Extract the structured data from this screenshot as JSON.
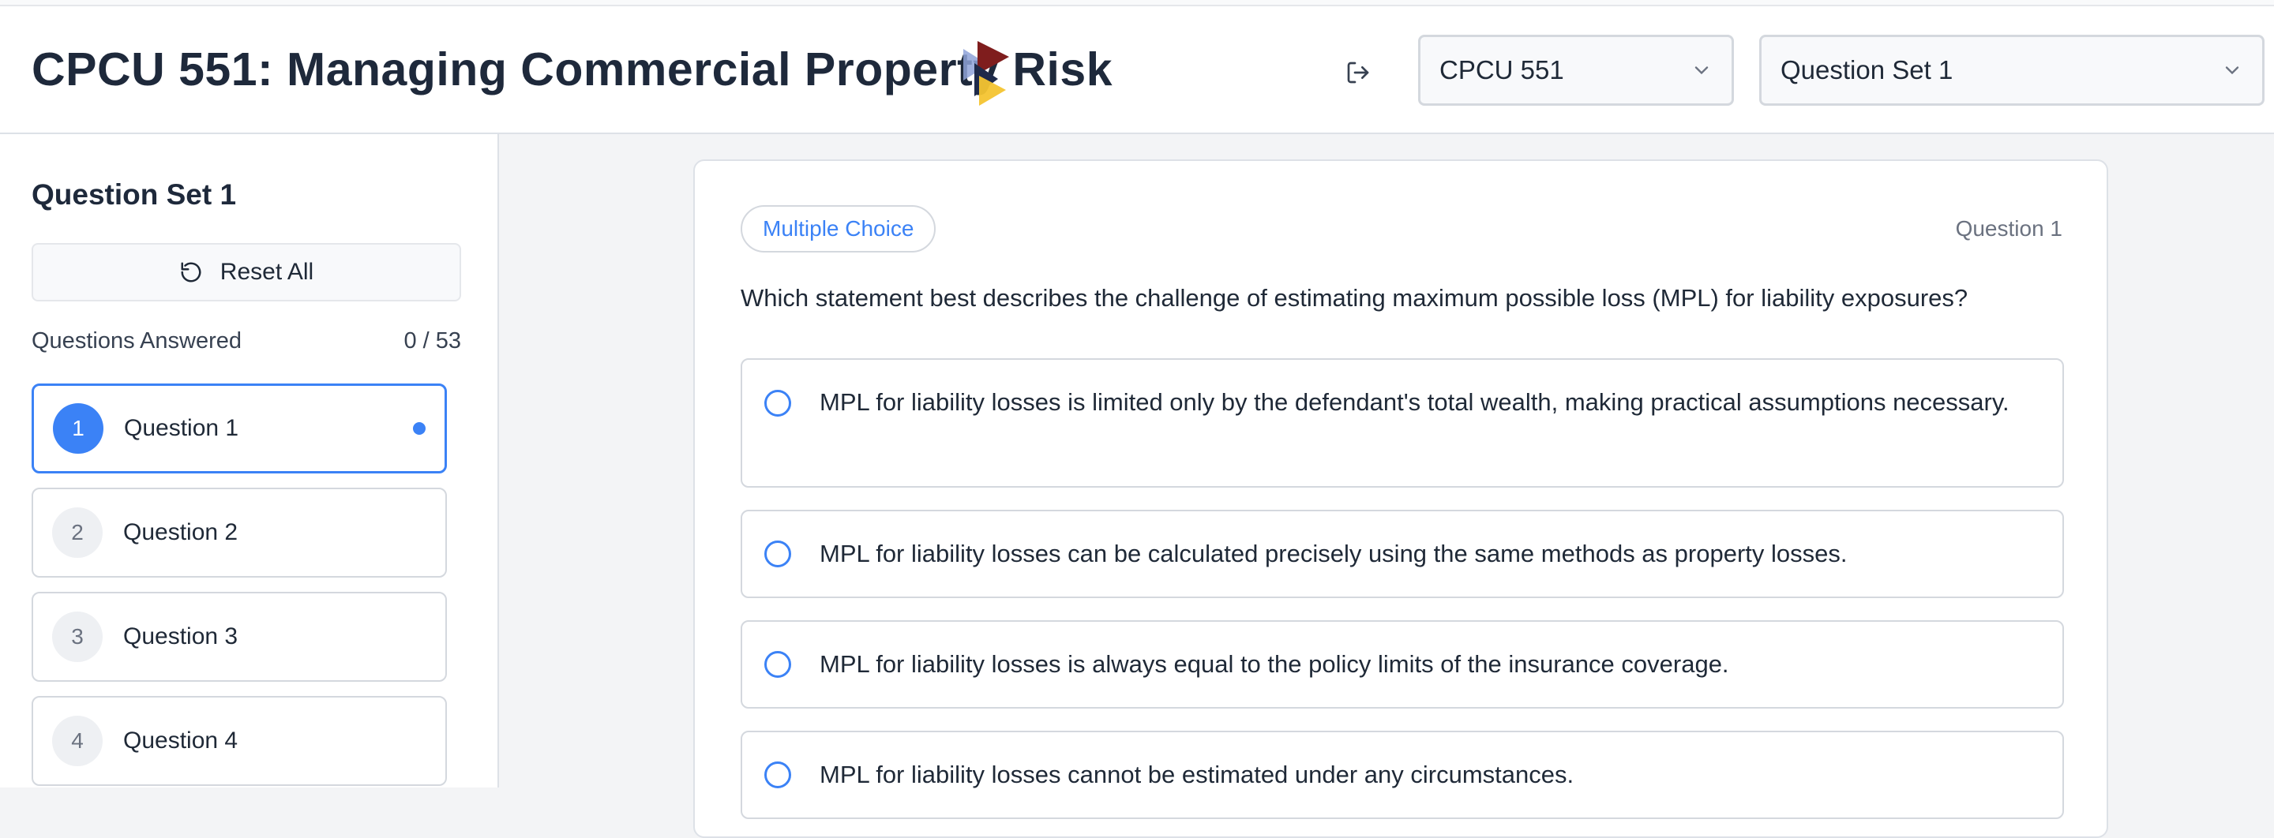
{
  "header": {
    "title": "CPCU 551: Managing Commercial Property Risk",
    "course_select": {
      "value": "CPCU 551"
    },
    "set_select": {
      "value": "Question Set 1"
    }
  },
  "sidebar": {
    "title": "Question Set 1",
    "reset_label": "Reset All",
    "answered_label": "Questions Answered",
    "answered_count": "0 / 53",
    "questions": [
      {
        "num": "1",
        "label": "Question 1",
        "active": true
      },
      {
        "num": "2",
        "label": "Question 2",
        "active": false
      },
      {
        "num": "3",
        "label": "Question 3",
        "active": false
      },
      {
        "num": "4",
        "label": "Question 4",
        "active": false
      }
    ]
  },
  "question": {
    "type_badge": "Multiple Choice",
    "number_label": "Question 1",
    "text": "Which statement best describes the challenge of estimating maximum possible loss (MPL) for liability exposures?",
    "options": [
      "MPL for liability losses is limited only by the defendant's total wealth, making practical assumptions necessary.",
      "MPL for liability losses can be calculated precisely using the same methods as property losses.",
      "MPL for liability losses is always equal to the policy limits of the insurance coverage.",
      "MPL for liability losses cannot be estimated under any circumstances."
    ]
  },
  "colors": {
    "accent": "#3b82f6",
    "title": "#1e293b",
    "border": "#d4d8de",
    "background": "#f3f4f6"
  }
}
